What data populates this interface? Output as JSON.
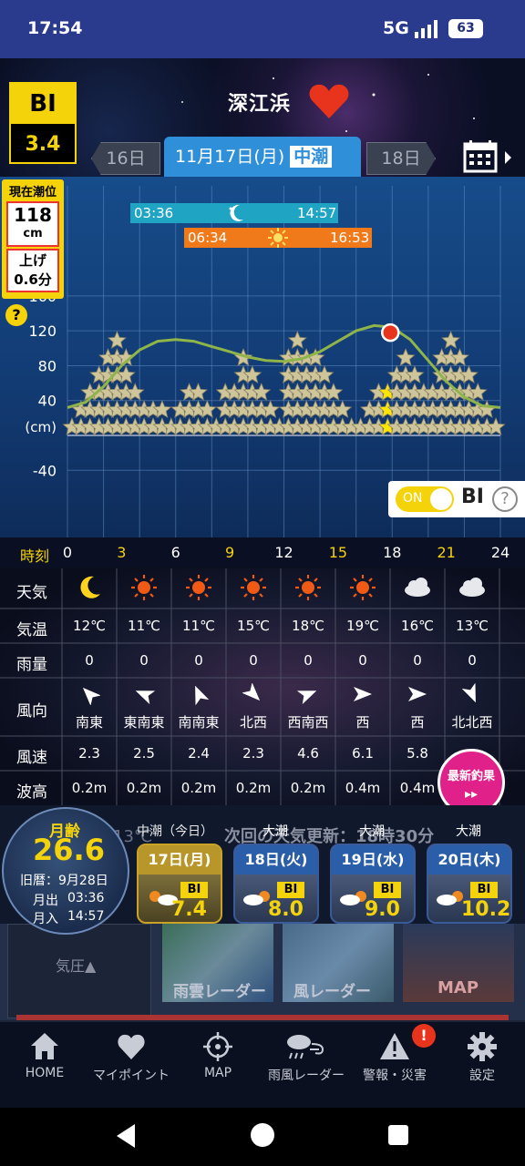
{
  "status": {
    "time": "17:54",
    "network": "5G",
    "battery": "63"
  },
  "header": {
    "bi_label": "BI",
    "bi_value": "3.4",
    "location": "深江浜",
    "prev_day": "16日",
    "current_date": "11月17日(月)",
    "tide_name": "中潮",
    "next_day": "18日"
  },
  "tide_panel": {
    "title": "現在潮位",
    "level_value": "118",
    "level_unit": "cm",
    "trend": "上げ",
    "rate": "0.6分",
    "help": "?"
  },
  "moon_times": {
    "rise": "03:36",
    "set": "14:57"
  },
  "sun_times": {
    "rise": "06:34",
    "set": "16:53"
  },
  "chart_data": {
    "type": "line",
    "ylabel": "(cm)",
    "yticks": [
      "160",
      "120",
      "80",
      "40",
      "-40"
    ],
    "ylim": [
      -40,
      160
    ],
    "xlim": [
      0,
      24
    ],
    "tide_curve": [
      {
        "x": 0,
        "y": 32
      },
      {
        "x": 1,
        "y": 38
      },
      {
        "x": 2,
        "y": 56
      },
      {
        "x": 3,
        "y": 80
      },
      {
        "x": 4,
        "y": 98
      },
      {
        "x": 5,
        "y": 108
      },
      {
        "x": 6,
        "y": 110
      },
      {
        "x": 7,
        "y": 108
      },
      {
        "x": 8,
        "y": 102
      },
      {
        "x": 9,
        "y": 96
      },
      {
        "x": 10,
        "y": 90
      },
      {
        "x": 11,
        "y": 86
      },
      {
        "x": 12,
        "y": 85
      },
      {
        "x": 13,
        "y": 88
      },
      {
        "x": 14,
        "y": 96
      },
      {
        "x": 15,
        "y": 108
      },
      {
        "x": 16,
        "y": 120
      },
      {
        "x": 17,
        "y": 126
      },
      {
        "x": 18,
        "y": 124
      },
      {
        "x": 19,
        "y": 110
      },
      {
        "x": 20,
        "y": 86
      },
      {
        "x": 21,
        "y": 62
      },
      {
        "x": 22,
        "y": 44
      },
      {
        "x": 23,
        "y": 34
      },
      {
        "x": 24,
        "y": 32
      }
    ],
    "current_point": {
      "x": 17.9,
      "y": 118
    },
    "bi_stars": [
      1,
      2,
      3,
      4,
      5,
      6,
      5,
      3,
      2,
      2,
      2,
      1,
      2,
      3,
      3,
      2,
      1,
      3,
      3,
      5,
      4,
      3,
      2,
      1,
      5,
      6,
      5,
      5,
      4,
      3,
      2,
      1,
      1,
      2,
      3,
      3,
      4,
      5,
      4,
      3,
      3,
      5,
      6,
      5,
      4,
      3,
      2,
      1
    ],
    "highlight_index": 35
  },
  "bi_switch": {
    "state": "ON",
    "label": "BI",
    "help": "?"
  },
  "time_axis": {
    "label": "時刻",
    "ticks": [
      "0",
      "3",
      "6",
      "9",
      "12",
      "15",
      "18",
      "21",
      "24"
    ]
  },
  "weather": {
    "labels": {
      "weather": "天気",
      "temp": "気温",
      "rain": "雨量",
      "wind_dir": "風向",
      "wind_speed": "風速",
      "wave": "波高"
    },
    "columns": [
      {
        "icon": "moon",
        "temp": "12℃",
        "rain": "0",
        "dir": "南東",
        "angle": 315,
        "speed": "2.3",
        "wave": "0.2m"
      },
      {
        "icon": "sun",
        "temp": "11℃",
        "rain": "0",
        "dir": "東南東",
        "angle": 292,
        "speed": "2.5",
        "wave": "0.2m"
      },
      {
        "icon": "sun",
        "temp": "11℃",
        "rain": "0",
        "dir": "南南東",
        "angle": 337,
        "speed": "2.4",
        "wave": "0.2m"
      },
      {
        "icon": "sun",
        "temp": "15℃",
        "rain": "0",
        "dir": "北西",
        "angle": 135,
        "speed": "2.3",
        "wave": "0.2m"
      },
      {
        "icon": "sun",
        "temp": "18℃",
        "rain": "0",
        "dir": "西南西",
        "angle": 68,
        "speed": "4.6",
        "wave": "0.2m"
      },
      {
        "icon": "sun",
        "temp": "19℃",
        "rain": "0",
        "dir": "西",
        "angle": 90,
        "speed": "6.1",
        "wave": "0.4m"
      },
      {
        "icon": "cloud",
        "temp": "16℃",
        "rain": "0",
        "dir": "西",
        "angle": 90,
        "speed": "5.8",
        "wave": "0.4m"
      },
      {
        "icon": "cloud",
        "temp": "13℃",
        "rain": "0",
        "dir": "北北西",
        "angle": 157,
        "speed": "",
        "wave": ""
      }
    ]
  },
  "latest_catch": {
    "line1": "最新釣果",
    "line2": "▸▸"
  },
  "moon_age": {
    "label": "月齢",
    "value": "26.6",
    "old_calendar": "旧暦：9月28日",
    "moonrise_label": "月出",
    "moonrise": "03:36",
    "moonset_label": "月入",
    "moonset": "14:57"
  },
  "forecast": {
    "today_label": "中潮（今日）",
    "update_notice": "次回の天気更新：18時30分",
    "ghost_temp": "13℃",
    "cards": [
      {
        "tide": "",
        "date": "17日(月)",
        "bi": "BI",
        "value": "7.4"
      },
      {
        "tide": "大潮",
        "date": "18日(火)",
        "bi": "BI",
        "value": "8.0"
      },
      {
        "tide": "大潮",
        "date": "19日(水)",
        "bi": "BI",
        "value": "9.0"
      },
      {
        "tide": "大潮",
        "date": "20日(木)",
        "bi": "BI",
        "value": "10.2"
      }
    ]
  },
  "lower_tabs": {
    "pressure": "気圧▲",
    "rain_radar": "雨雲レーダー",
    "wind_radar": "風レーダー",
    "map": "MAP"
  },
  "nav": {
    "home": "HOME",
    "mypoint": "マイポイント",
    "map": "MAP",
    "radar": "雨風レーダー",
    "alerts": "警報・災害",
    "alerts_badge": "!",
    "settings": "設定"
  },
  "colors": {
    "accent": "#f5d30a",
    "header_blue": "#2f8fd8",
    "status_bar": "#2a3a8c",
    "moon_bar": "#1fa4c4",
    "sun_bar": "#f07a1a"
  }
}
